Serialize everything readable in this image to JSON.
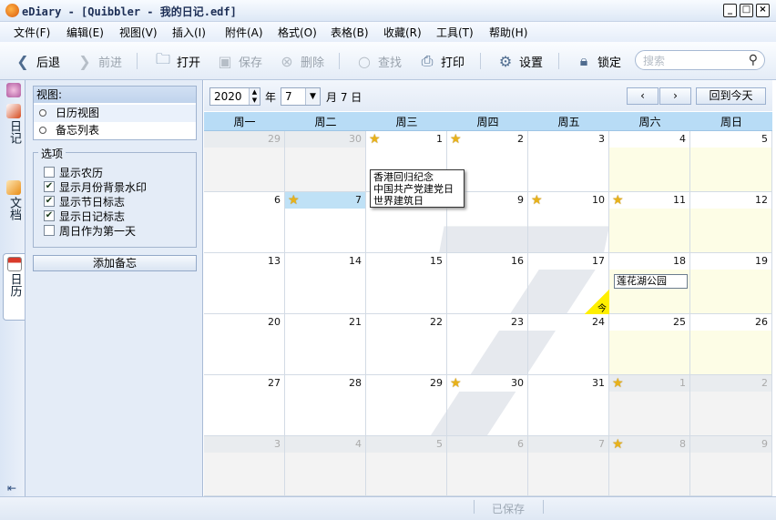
{
  "window": {
    "title": "eDiary - [Quibbler - 我的日记.edf]"
  },
  "menu": [
    "文件(F)",
    "编辑(E)",
    "视图(V)",
    "插入(I)",
    "附件(A)",
    "格式(O)",
    "表格(B)",
    "收藏(R)",
    "工具(T)",
    "帮助(H)"
  ],
  "toolbar": {
    "back": "后退",
    "forward": "前进",
    "open": "打开",
    "save": "保存",
    "delete": "删除",
    "find": "查找",
    "print": "打印",
    "settings": "设置",
    "lock": "锁定",
    "search_placeholder": "搜索"
  },
  "left_tabs": {
    "diary": "日记",
    "docs": "文档",
    "calendar": "日历"
  },
  "side": {
    "view_title": "视图:",
    "view_options": [
      "日历视图",
      "备忘列表"
    ],
    "options_title": "选项",
    "options": [
      {
        "label": "显示农历",
        "checked": false
      },
      {
        "label": "显示月份背景水印",
        "checked": true
      },
      {
        "label": "显示节日标志",
        "checked": true
      },
      {
        "label": "显示日记标志",
        "checked": true
      },
      {
        "label": "周日作为第一天",
        "checked": false
      }
    ],
    "add_memo": "添加备忘"
  },
  "nav": {
    "year": "2020",
    "year_label": "年",
    "month": "7",
    "month_day_label": "月 7 日",
    "today_button": "回到今天",
    "prev": "‹",
    "next": "›"
  },
  "weekdays": [
    "周一",
    "周二",
    "周三",
    "周四",
    "周五",
    "周六",
    "周日"
  ],
  "watermark": "7",
  "weeks": [
    [
      {
        "d": "29",
        "o": true
      },
      {
        "d": "30",
        "o": true
      },
      {
        "d": "1",
        "star": true
      },
      {
        "d": "2",
        "star": true
      },
      {
        "d": "3"
      },
      {
        "d": "4",
        "w": true
      },
      {
        "d": "5",
        "w": true
      }
    ],
    [
      {
        "d": "6"
      },
      {
        "d": "7",
        "star": true,
        "sel": true
      },
      {
        "d": "8"
      },
      {
        "d": "9"
      },
      {
        "d": "10",
        "star": true
      },
      {
        "d": "11",
        "w": true,
        "star": true
      },
      {
        "d": "12",
        "w": true
      }
    ],
    [
      {
        "d": "13"
      },
      {
        "d": "14"
      },
      {
        "d": "15"
      },
      {
        "d": "16"
      },
      {
        "d": "17"
      },
      {
        "d": "18",
        "w": true
      },
      {
        "d": "19",
        "w": true
      }
    ],
    [
      {
        "d": "20"
      },
      {
        "d": "21"
      },
      {
        "d": "22"
      },
      {
        "d": "23"
      },
      {
        "d": "24"
      },
      {
        "d": "25",
        "w": true
      },
      {
        "d": "26",
        "w": true
      }
    ],
    [
      {
        "d": "27"
      },
      {
        "d": "28"
      },
      {
        "d": "29"
      },
      {
        "d": "30",
        "star": true
      },
      {
        "d": "31"
      },
      {
        "d": "1",
        "o": true,
        "star": true
      },
      {
        "d": "2",
        "o": true
      }
    ],
    [
      {
        "d": "3",
        "o": true
      },
      {
        "d": "4",
        "o": true
      },
      {
        "d": "5",
        "o": true
      },
      {
        "d": "6",
        "o": true
      },
      {
        "d": "7",
        "o": true
      },
      {
        "d": "8",
        "o": true,
        "star": true
      },
      {
        "d": "9",
        "o": true
      }
    ]
  ],
  "holiday_popup": [
    "香港回归纪念",
    "中国共产党建党日",
    "世界建筑日"
  ],
  "memo": "莲花湖公园",
  "today_label": "今",
  "status": "已保存"
}
